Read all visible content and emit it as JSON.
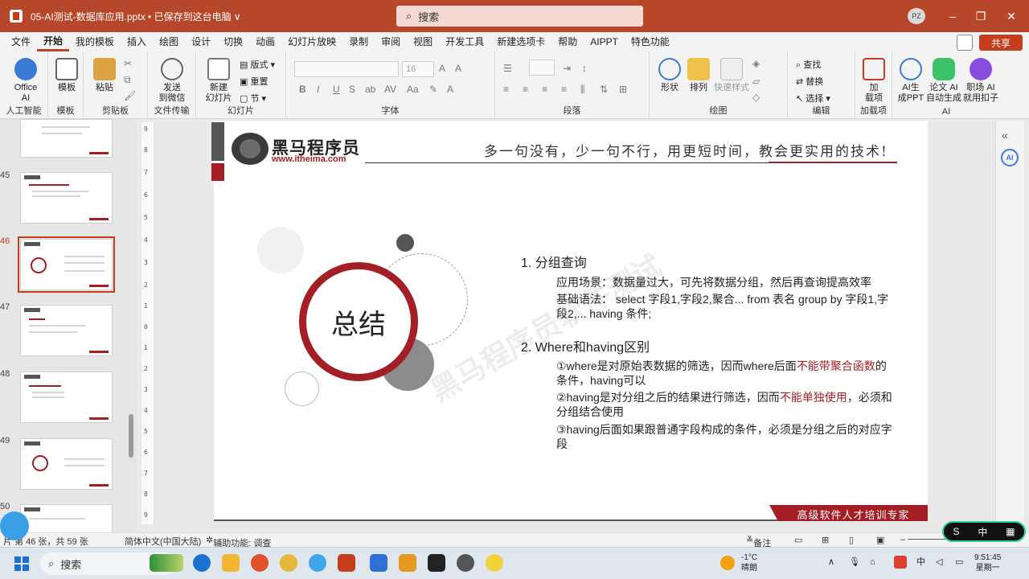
{
  "window": {
    "title": "05-AI测试-数据库应用.pptx • 已保存到这台电脑 ∨",
    "search_placeholder": "搜索",
    "avatar": "PZ"
  },
  "menu": {
    "tabs": [
      "文件",
      "开始",
      "我的模板",
      "插入",
      "绘图",
      "设计",
      "切换",
      "动画",
      "幻灯片放映",
      "录制",
      "审阅",
      "视图",
      "开发工具",
      "新建选项卡",
      "帮助",
      "AIPPT",
      "特色功能"
    ],
    "share": "共享"
  },
  "ribbon": {
    "office_ai": "Office\nAI",
    "template": "模板",
    "paste": "粘贴",
    "send_wechat": "发送\n到微信",
    "new_slide": "新建\n幻灯片",
    "layout": "版式",
    "reset": "重置",
    "section": "节",
    "font_size": "16",
    "shape": "形状",
    "arrange": "排列",
    "quick_style": "快速样式",
    "find": "查找",
    "replace": "替换",
    "select": "选择",
    "addin": "加\n载项",
    "ai_ppt": "AI生\n成PPT",
    "paper_ai": "论文 AI\n自动生成",
    "workplace_ai": "职场 AI\n就用扣子",
    "groups": {
      "ai_smart": "人工智能",
      "template": "模板",
      "clipboard": "剪贴板",
      "file_transfer": "文件传输",
      "slides": "幻灯片",
      "font": "字体",
      "paragraph": "段落",
      "drawing": "绘图",
      "editing": "编辑",
      "addins": "加载项",
      "ai": "AI"
    }
  },
  "thumbnails": {
    "numbers": [
      "45",
      "46",
      "47",
      "48",
      "49",
      "50"
    ]
  },
  "slide": {
    "logo_text": "黑马程序员",
    "logo_url": "www.itheima.com",
    "slogan": "多一句没有，少一句不行，用更短时间，教会更实用的技术!",
    "watermark": "黑马程序员软件测试",
    "summary": "总结",
    "s1_title": "1.  分组查询",
    "s1_line1": "应用场景：数据量过大，可先将数据分组，然后再查询提高效率",
    "s1_line2": "基础语法： select 字段1,字段2,聚合... from 表名 group by 字段1,字段2,... having 条件;",
    "s2_title": "2.  Where和having区别",
    "p1_a": "①where是对原始表数据的筛选，因而where后面",
    "p1_red": "不能带聚合函数",
    "p1_b": "的条件，having可以",
    "p2_a": "②having是对分组之后的结果进行筛选，因而",
    "p2_red": "不能单独使用",
    "p2_b": "，必须和分组结合使用",
    "p3": "③having后面如果跟普通字段构成的条件，必须是分组之后的对应字段",
    "footer": "高级软件人才培训专家"
  },
  "status": {
    "slide_info": "片 第 46 张，共 59 张",
    "language": "简体中文(中国大陆)",
    "accessibility": "辅助功能: 调查",
    "notes": "备注",
    "ime": "中"
  },
  "taskbar": {
    "search": "搜索",
    "weather_temp": "-1°C",
    "weather_desc": "晴朗",
    "time": "9:51:45",
    "day": "星期一"
  }
}
